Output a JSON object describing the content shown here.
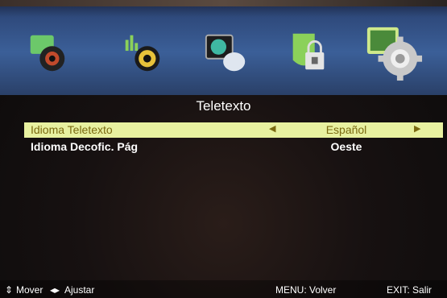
{
  "menu": {
    "icons": [
      {
        "name": "picture-icon"
      },
      {
        "name": "sound-icon"
      },
      {
        "name": "channel-icon"
      },
      {
        "name": "lock-icon"
      },
      {
        "name": "setup-icon",
        "selected": true
      }
    ]
  },
  "panel": {
    "title": "Teletexto",
    "rows": [
      {
        "label": "Idioma Teletexto",
        "value": "Español",
        "selected": true
      },
      {
        "label": "Idioma Decofic. Pág",
        "value": "Oeste",
        "selected": false
      }
    ]
  },
  "footer": {
    "move": "Mover",
    "adjust": "Ajustar",
    "menu": "MENU: Volver",
    "exit": "EXIT: Salir"
  },
  "colors": {
    "highlight": "#e8f1a0",
    "highlight_text": "#7a6a10"
  }
}
